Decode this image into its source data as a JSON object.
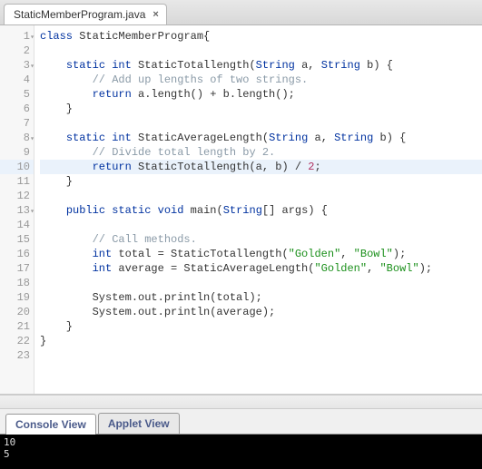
{
  "tab": {
    "filename": "StaticMemberProgram.java",
    "close_glyph": "×"
  },
  "editor": {
    "highlighted_line": 10,
    "fold_lines": [
      1,
      3,
      8,
      13
    ],
    "lines": [
      {
        "n": 1,
        "tokens": [
          {
            "t": "kw",
            "v": "class"
          },
          {
            "t": "pn",
            "v": " "
          },
          {
            "t": "id",
            "v": "StaticMemberProgram"
          },
          {
            "t": "pn",
            "v": "{"
          }
        ]
      },
      {
        "n": 2,
        "tokens": []
      },
      {
        "n": 3,
        "tokens": [
          {
            "t": "pn",
            "v": "    "
          },
          {
            "t": "kw",
            "v": "static"
          },
          {
            "t": "pn",
            "v": " "
          },
          {
            "t": "type",
            "v": "int"
          },
          {
            "t": "pn",
            "v": " "
          },
          {
            "t": "id",
            "v": "StaticTotallength"
          },
          {
            "t": "pn",
            "v": "("
          },
          {
            "t": "type",
            "v": "String"
          },
          {
            "t": "pn",
            "v": " a, "
          },
          {
            "t": "type",
            "v": "String"
          },
          {
            "t": "pn",
            "v": " b) {"
          }
        ]
      },
      {
        "n": 4,
        "tokens": [
          {
            "t": "pn",
            "v": "        "
          },
          {
            "t": "cm",
            "v": "// Add up lengths of two strings."
          }
        ]
      },
      {
        "n": 5,
        "tokens": [
          {
            "t": "pn",
            "v": "        "
          },
          {
            "t": "kw",
            "v": "return"
          },
          {
            "t": "pn",
            "v": " a.length() + b.length();"
          }
        ]
      },
      {
        "n": 6,
        "tokens": [
          {
            "t": "pn",
            "v": "    }"
          }
        ]
      },
      {
        "n": 7,
        "tokens": []
      },
      {
        "n": 8,
        "tokens": [
          {
            "t": "pn",
            "v": "    "
          },
          {
            "t": "kw",
            "v": "static"
          },
          {
            "t": "pn",
            "v": " "
          },
          {
            "t": "type",
            "v": "int"
          },
          {
            "t": "pn",
            "v": " "
          },
          {
            "t": "id",
            "v": "StaticAverageLength"
          },
          {
            "t": "pn",
            "v": "("
          },
          {
            "t": "type",
            "v": "String"
          },
          {
            "t": "pn",
            "v": " a, "
          },
          {
            "t": "type",
            "v": "String"
          },
          {
            "t": "pn",
            "v": " b) {"
          }
        ]
      },
      {
        "n": 9,
        "tokens": [
          {
            "t": "pn",
            "v": "        "
          },
          {
            "t": "cm",
            "v": "// Divide total length by 2."
          }
        ]
      },
      {
        "n": 10,
        "tokens": [
          {
            "t": "pn",
            "v": "        "
          },
          {
            "t": "kw",
            "v": "return"
          },
          {
            "t": "pn",
            "v": " StaticTotallength(a, b) / "
          },
          {
            "t": "num",
            "v": "2"
          },
          {
            "t": "pn",
            "v": ";"
          }
        ]
      },
      {
        "n": 11,
        "tokens": [
          {
            "t": "pn",
            "v": "    }"
          }
        ]
      },
      {
        "n": 12,
        "tokens": []
      },
      {
        "n": 13,
        "tokens": [
          {
            "t": "pn",
            "v": "    "
          },
          {
            "t": "kw",
            "v": "public"
          },
          {
            "t": "pn",
            "v": " "
          },
          {
            "t": "kw",
            "v": "static"
          },
          {
            "t": "pn",
            "v": " "
          },
          {
            "t": "type",
            "v": "void"
          },
          {
            "t": "pn",
            "v": " "
          },
          {
            "t": "id",
            "v": "main"
          },
          {
            "t": "pn",
            "v": "("
          },
          {
            "t": "type",
            "v": "String"
          },
          {
            "t": "pn",
            "v": "[] args) {"
          }
        ]
      },
      {
        "n": 14,
        "tokens": []
      },
      {
        "n": 15,
        "tokens": [
          {
            "t": "pn",
            "v": "        "
          },
          {
            "t": "cm",
            "v": "// Call methods."
          }
        ]
      },
      {
        "n": 16,
        "tokens": [
          {
            "t": "pn",
            "v": "        "
          },
          {
            "t": "type",
            "v": "int"
          },
          {
            "t": "pn",
            "v": " total = StaticTotallength("
          },
          {
            "t": "str",
            "v": "\"Golden\""
          },
          {
            "t": "pn",
            "v": ", "
          },
          {
            "t": "str",
            "v": "\"Bowl\""
          },
          {
            "t": "pn",
            "v": ");"
          }
        ]
      },
      {
        "n": 17,
        "tokens": [
          {
            "t": "pn",
            "v": "        "
          },
          {
            "t": "type",
            "v": "int"
          },
          {
            "t": "pn",
            "v": " average = StaticAverageLength("
          },
          {
            "t": "str",
            "v": "\"Golden\""
          },
          {
            "t": "pn",
            "v": ", "
          },
          {
            "t": "str",
            "v": "\"Bowl\""
          },
          {
            "t": "pn",
            "v": ");"
          }
        ]
      },
      {
        "n": 18,
        "tokens": []
      },
      {
        "n": 19,
        "tokens": [
          {
            "t": "pn",
            "v": "        System.out.println(total);"
          }
        ]
      },
      {
        "n": 20,
        "tokens": [
          {
            "t": "pn",
            "v": "        System.out.println(average);"
          }
        ]
      },
      {
        "n": 21,
        "tokens": [
          {
            "t": "pn",
            "v": "    }"
          }
        ]
      },
      {
        "n": 22,
        "tokens": [
          {
            "t": "pn",
            "v": "}"
          }
        ]
      },
      {
        "n": 23,
        "tokens": []
      }
    ]
  },
  "views": {
    "console_label": "Console View",
    "applet_label": "Applet View"
  },
  "console_output": "10\n5"
}
